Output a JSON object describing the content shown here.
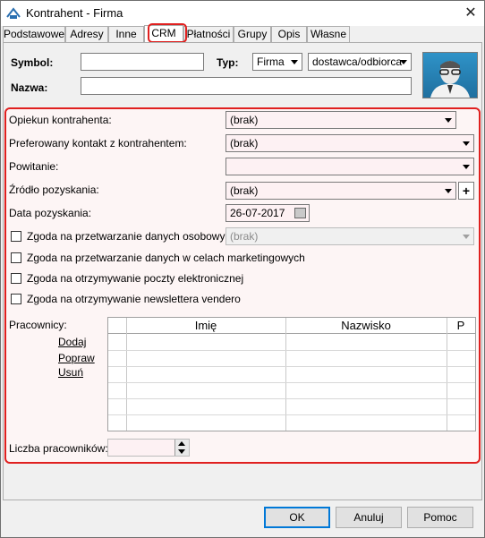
{
  "window": {
    "title": "Kontrahent - Firma",
    "close_glyph": "✕"
  },
  "tabs": [
    {
      "label": "Podstawowe"
    },
    {
      "label": "Adresy"
    },
    {
      "label": "Inne"
    },
    {
      "label": "CRM"
    },
    {
      "label": "Płatności"
    },
    {
      "label": "Grupy"
    },
    {
      "label": "Opis"
    },
    {
      "label": "Własne"
    }
  ],
  "header": {
    "symbol_label": "Symbol:",
    "symbol_value": "",
    "typ_label": "Typ:",
    "typ_value": "Firma",
    "role_value": "dostawca/odbiorca",
    "nazwa_label": "Nazwa:",
    "nazwa_value": ""
  },
  "crm": {
    "opiekun_label": "Opiekun kontrahenta:",
    "opiekun_value": "(brak)",
    "preferowany_label": "Preferowany kontakt z kontrahentem:",
    "preferowany_value": "(brak)",
    "powitanie_label": "Powitanie:",
    "powitanie_value": "",
    "zrodlo_label": "Źródło pozyskania:",
    "zrodlo_value": "(brak)",
    "zrodlo_add": "+",
    "data_label": "Data pozyskania:",
    "data_value": "26-07-2017",
    "zgoda_osobowe_label": "Zgoda na przetwarzanie danych osobowych",
    "zgoda_osobowe_value": "(brak)",
    "zgoda_marketing_label": "Zgoda na przetwarzanie danych w celach marketingowych",
    "zgoda_poczta_label": "Zgoda na otrzymywanie poczty elektronicznej",
    "zgoda_newsletter_label": "Zgoda na otrzymywanie newslettera vendero",
    "pracownicy_label": "Pracownicy:",
    "dodaj": "Dodaj",
    "popraw": "Popraw",
    "usun": "Usuń",
    "columns": [
      "Imię",
      "Nazwisko",
      "P"
    ],
    "liczba_label": "Liczba pracowników:",
    "liczba_value": ""
  },
  "footer": {
    "ok": "OK",
    "anuluj": "Anuluj",
    "pomoc": "Pomoc"
  },
  "colors": {
    "highlight": "#e0201f",
    "avatar_bg": "#2f93c8"
  }
}
